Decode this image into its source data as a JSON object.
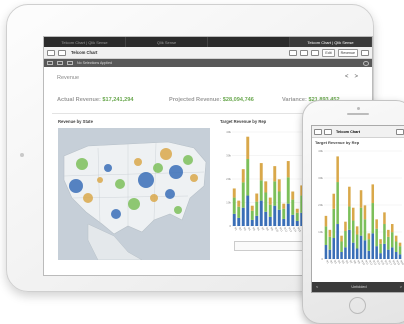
{
  "tablet": {
    "tabs": [
      "Telcom Chart | Qlik Sense",
      "Qlik Sense",
      "",
      "Telcom Chart | Qlik Sense"
    ],
    "active_tab": 3,
    "toolbar": {
      "app_title": "Telcom Chart",
      "edit_label": "Edit",
      "sheet_label": "Revenue"
    },
    "selections_text": "No Selections Applied",
    "kpi": {
      "title": "Revenue",
      "nav_prev": "<",
      "nav_next": ">",
      "actual_label": "Actual Revenue:",
      "actual_value": "$17,241,294",
      "projected_label": "Projected Revenue:",
      "projected_value": "$28,094,746",
      "variance_label": "Variance:",
      "variance_value": "$21,893,452"
    },
    "map_title": "Revenue by State",
    "chart_title": "Target Revenue by Rep",
    "colors": {
      "blue": "#3a6fb7",
      "green": "#7cbf5a",
      "gold": "#d9a84a",
      "accent": "#6aa84f"
    }
  },
  "phone": {
    "app_title": "Telcom Chart",
    "chart_title": "Target Revenue by Rep",
    "bottom_label": "Unfolded"
  },
  "chart_data": [
    {
      "type": "bar",
      "title": "Target Revenue by Rep",
      "ylabels": [
        "40k",
        "30k",
        "20k",
        "10k",
        "0"
      ],
      "categories": [
        "R1",
        "R2",
        "R3",
        "R4",
        "R5",
        "R6",
        "R7",
        "R8",
        "R9",
        "R10",
        "R11",
        "R12",
        "R13",
        "R14",
        "R15",
        "R16",
        "R17",
        "R18",
        "R19",
        "R20"
      ],
      "series": [
        {
          "color": "#3a6fb7",
          "values": [
            12,
            8,
            18,
            30,
            6,
            10,
            25,
            14,
            9,
            20,
            16,
            7,
            22,
            11,
            5,
            13,
            8,
            10,
            6,
            4
          ]
        },
        {
          "color": "#7cbf5a",
          "values": [
            16,
            11,
            25,
            36,
            9,
            14,
            20,
            19,
            12,
            24,
            18,
            10,
            26,
            15,
            8,
            17,
            11,
            13,
            9,
            7
          ]
        },
        {
          "color": "#d9a84a",
          "values": [
            9,
            6,
            13,
            22,
            5,
            8,
            17,
            11,
            7,
            15,
            12,
            5,
            16,
            8,
            4,
            10,
            6,
            7,
            5,
            3
          ]
        }
      ]
    }
  ]
}
